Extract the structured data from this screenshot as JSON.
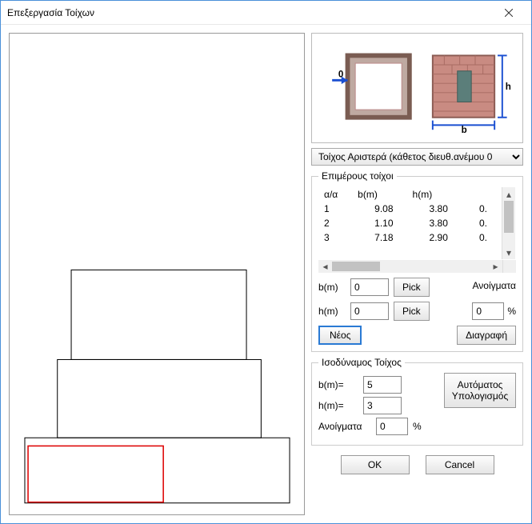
{
  "window": {
    "title": "Επεξεργασία Τοίχων"
  },
  "dropdown": {
    "selected": "Τοίχος Αριστερά (κάθετος διευθ.ανέμου 0"
  },
  "sub_walls": {
    "legend": "Επιμέρους τοίχοι",
    "headers": {
      "aa": "α/α",
      "b": "b(m)",
      "h": "h(m)"
    },
    "rows": [
      {
        "aa": "1",
        "b": "9.08",
        "h": "3.80",
        "extra": "0."
      },
      {
        "aa": "2",
        "b": "1.10",
        "h": "3.80",
        "extra": "0."
      },
      {
        "aa": "3",
        "b": "7.18",
        "h": "2.90",
        "extra": "0."
      }
    ],
    "b_label": "b(m)",
    "b_value": "0",
    "h_label": "h(m)",
    "h_value": "0",
    "pick_label": "Pick",
    "new_label": "Νέος",
    "openings_label": "Ανοίγματα",
    "openings_value": "0",
    "openings_unit": "%",
    "delete_label": "Διαγραφή"
  },
  "equivalent": {
    "legend": "Ισοδύναμος Τοίχος",
    "b_label": "b(m)=",
    "b_value": "5",
    "h_label": "h(m)=",
    "h_value": "3",
    "openings_label": "Ανοίγματα",
    "openings_value": "0",
    "openings_unit": "%",
    "auto_label": "Αυτόματος Υπολογισμός"
  },
  "footer": {
    "ok": "OK",
    "cancel": "Cancel"
  },
  "diagram": {
    "origin_label": "0",
    "b_label": "b",
    "h_label": "h"
  }
}
